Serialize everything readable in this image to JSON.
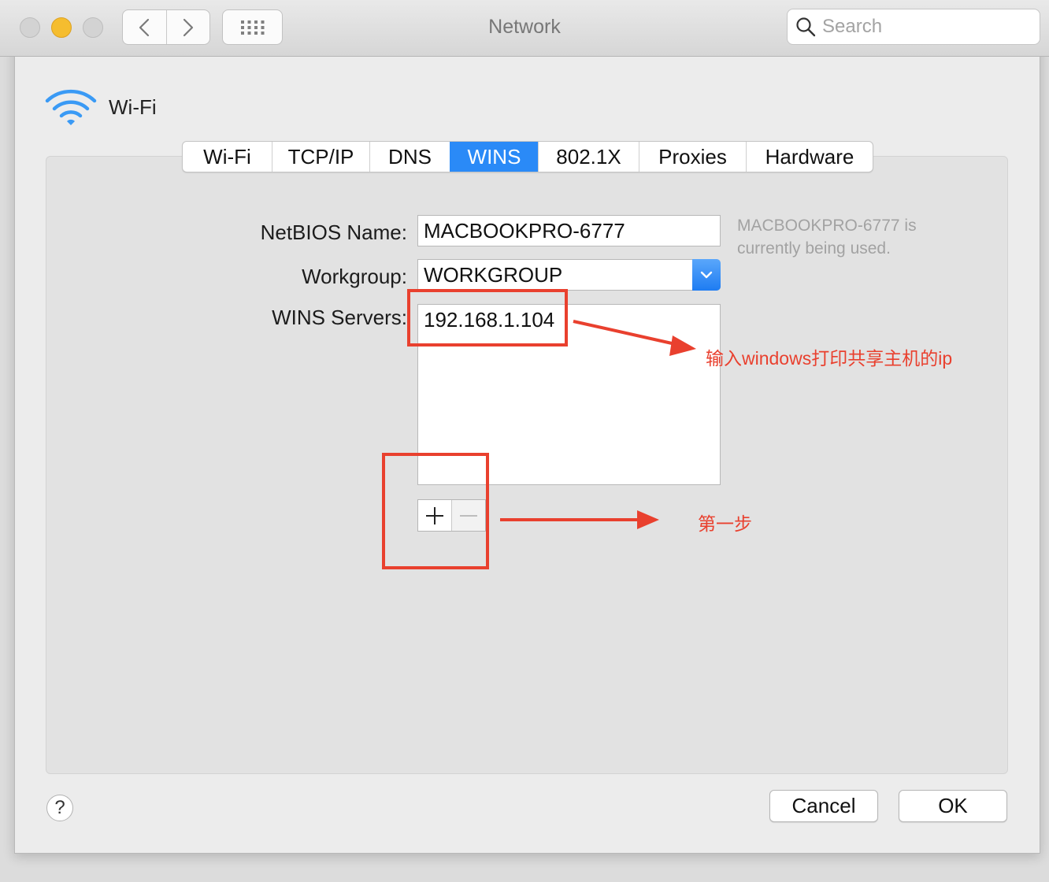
{
  "window": {
    "title": "Network"
  },
  "search": {
    "placeholder": "Search"
  },
  "service": {
    "name": "Wi-Fi"
  },
  "tabs": [
    {
      "label": "Wi-Fi"
    },
    {
      "label": "TCP/IP"
    },
    {
      "label": "DNS"
    },
    {
      "label": "WINS",
      "active": true
    },
    {
      "label": "802.1X"
    },
    {
      "label": "Proxies"
    },
    {
      "label": "Hardware"
    }
  ],
  "wins": {
    "netbios_label": "NetBIOS Name:",
    "netbios_value": "MACBOOKPRO-6777",
    "netbios_hint": "MACBOOKPRO-6777 is currently being used.",
    "workgroup_label": "Workgroup:",
    "workgroup_value": "WORKGROUP",
    "servers_label": "WINS Servers:",
    "servers": [
      "192.168.1.104"
    ]
  },
  "annotations": {
    "ip_note": "输入windows打印共享主机的ip",
    "step_note": "第一步",
    "color": "#e9402e"
  },
  "buttons": {
    "help": "?",
    "cancel": "Cancel",
    "ok": "OK"
  },
  "colors": {
    "accent": "#2a8af7",
    "minimize": "#f5bd2f"
  }
}
